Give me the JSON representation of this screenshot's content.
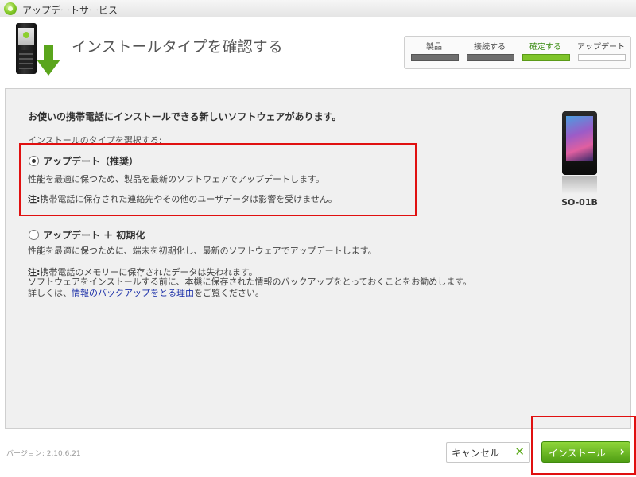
{
  "window": {
    "title": "アップデートサービス"
  },
  "header": {
    "title": "インストールタイプを確認する",
    "steps": [
      {
        "label": "製品",
        "status": "done"
      },
      {
        "label": "接続する",
        "status": "done"
      },
      {
        "label": "確定する",
        "status": "active"
      },
      {
        "label": "アップデート",
        "status": "pending"
      }
    ]
  },
  "main": {
    "intro": "お使いの携帯電話にインストールできる新しいソフトウェアがあります。",
    "select_label": "インストールのタイプを選択する:",
    "option_update": {
      "title": "アップデート（推奨）",
      "description": "性能を最適に保つため、製品を最新のソフトウェアでアップデートします。",
      "note_label": "注:",
      "note": "携帯電話に保存された連絡先やその他のユーザデータは影響を受けません。",
      "selected": true
    },
    "option_reset": {
      "title": "アップデート ＋ 初期化",
      "description": "性能を最適に保つために、端末を初期化し、最新のソフトウェアでアップデートします。",
      "note_label": "注:",
      "note_line1": "携帯電話のメモリーに保存されたデータは失われます。",
      "note_line2": "ソフトウェアをインストールする前に、本機に保存された情報のバックアップをとっておくことをお勧めします。",
      "note_line3_prefix": "詳しくは、",
      "note_link": "情報のバックアップをとる理由",
      "note_line3_suffix": "をご覧ください。",
      "selected": false
    },
    "device_name": "SO-01B"
  },
  "footer": {
    "version": "バージョン: 2.10.6.21",
    "cancel_label": "キャンセル",
    "install_label": "インストール"
  },
  "colors": {
    "accent_green": "#7fc42a",
    "highlight_red": "#e01010",
    "link_blue": "#1a2ea8"
  }
}
